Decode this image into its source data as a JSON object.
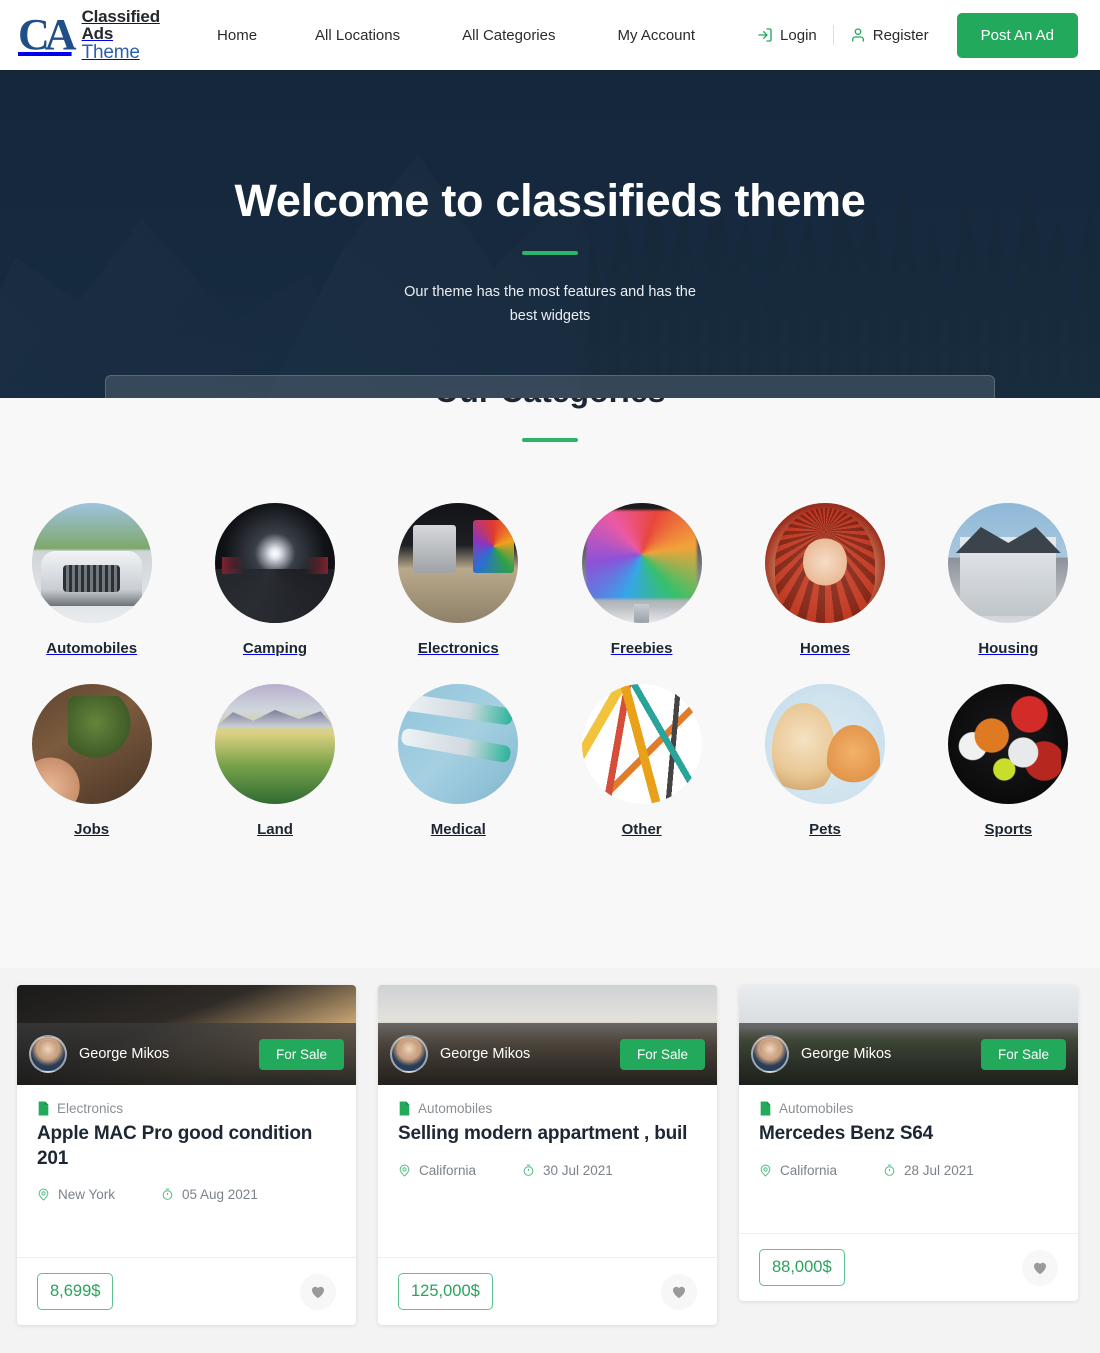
{
  "brand": {
    "mark": "CA",
    "line1": "Classified Ads",
    "line2": "Theme"
  },
  "nav": {
    "items": [
      {
        "label": "Home"
      },
      {
        "label": "All Locations"
      },
      {
        "label": "All Categories"
      },
      {
        "label": "My Account"
      }
    ]
  },
  "auth": {
    "login_label": "Login",
    "login_icon": "login-icon",
    "register_label": "Register",
    "register_icon": "user-icon",
    "post_ad_label": "Post An Ad"
  },
  "hero": {
    "title": "Welcome to classifieds theme",
    "subtitle": "Our theme has the most features and has the best widgets"
  },
  "categories_section": {
    "title": "Our Categories",
    "items": [
      {
        "label": "Automobiles",
        "art": "c-auto",
        "icon": "automobiles-thumb"
      },
      {
        "label": "Camping",
        "art": "c-camp",
        "icon": "camping-thumb"
      },
      {
        "label": "Electronics",
        "art": "c-elec",
        "icon": "electronics-thumb"
      },
      {
        "label": "Freebies",
        "art": "c-free",
        "icon": "freebies-thumb"
      },
      {
        "label": "Homes",
        "art": "c-home",
        "icon": "homes-thumb"
      },
      {
        "label": "Housing",
        "art": "c-hous",
        "icon": "housing-thumb"
      },
      {
        "label": "Jobs",
        "art": "c-jobs",
        "icon": "jobs-thumb"
      },
      {
        "label": "Land",
        "art": "c-land",
        "icon": "land-thumb"
      },
      {
        "label": "Medical",
        "art": "c-med",
        "icon": "medical-thumb"
      },
      {
        "label": "Other",
        "art": "c-other",
        "icon": "other-thumb"
      },
      {
        "label": "Pets",
        "art": "c-pets",
        "icon": "pets-thumb"
      },
      {
        "label": "Sports",
        "art": "c-sport",
        "icon": "sports-thumb"
      }
    ]
  },
  "listings": [
    {
      "author": "George Mikos",
      "badge": "For Sale",
      "category": "Electronics",
      "title": "Apple MAC Pro good condition 201",
      "location": "New York",
      "date": "05 Aug 2021",
      "price": "8,699$"
    },
    {
      "author": "George Mikos",
      "badge": "For Sale",
      "category": "Automobiles",
      "title": "Selling modern appartment , buil",
      "location": "California",
      "date": "30 Jul 2021",
      "price": "125,000$"
    },
    {
      "author": "George Mikos",
      "badge": "For Sale",
      "category": "Automobiles",
      "title": "Mercedes Benz S64",
      "location": "California",
      "date": "28 Jul 2021",
      "price": "88,000$"
    }
  ],
  "colors": {
    "accent_green": "#22a95c",
    "hero_overlay": "#15263a",
    "brand_blue": "#2f5fa8",
    "price_green": "#2aa35c"
  }
}
